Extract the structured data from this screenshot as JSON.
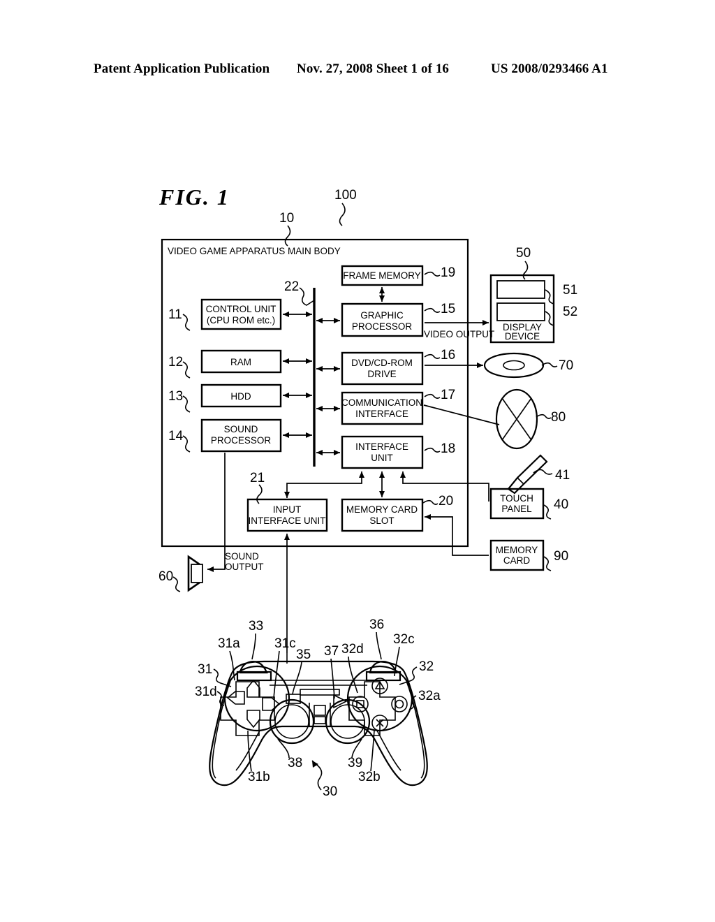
{
  "header": {
    "publication": "Patent Application Publication",
    "date_sheet": "Nov. 27, 2008  Sheet 1 of 16",
    "patent_number": "US 2008/0293466 A1"
  },
  "figure": {
    "label": "FIG.  1",
    "system_ref": "100",
    "main_body_ref": "10",
    "main_body_title": "VIDEO GAME APPARATUS MAIN BODY"
  },
  "blocks": {
    "control_unit": {
      "line1": "CONTROL UNIT",
      "line2": "(CPU ROM etc.)",
      "ref": "11"
    },
    "ram": {
      "line1": "RAM",
      "ref": "12"
    },
    "hdd": {
      "line1": "HDD",
      "ref": "13"
    },
    "sound_processor": {
      "line1": "SOUND",
      "line2": "PROCESSOR",
      "ref": "14"
    },
    "frame_memory": {
      "line1": "FRAME MEMORY",
      "ref": "19"
    },
    "graphic_processor": {
      "line1": "GRAPHIC",
      "line2": "PROCESSOR",
      "ref": "15"
    },
    "dvd_drive": {
      "line1": "DVD/CD-ROM",
      "line2": "DRIVE",
      "ref": "16"
    },
    "communication_interface": {
      "line1": "COMMUNICATION",
      "line2": "INTERFACE",
      "ref": "17"
    },
    "interface_unit": {
      "line1": "INTERFACE",
      "line2": "UNIT",
      "ref": "18"
    },
    "input_interface_unit": {
      "line1": "INPUT",
      "line2": "INTERFACE UNIT",
      "ref": "21"
    },
    "memory_card_slot": {
      "line1": "MEMORY CARD",
      "line2": "SLOT",
      "ref": "20"
    },
    "display_device": {
      "line1": "DISPLAY",
      "line2": "DEVICE",
      "ref": "50",
      "screen_upper_ref": "51",
      "screen_lower_ref": "52"
    },
    "touch_panel": {
      "line1": "TOUCH",
      "line2": "PANEL",
      "ref": "40",
      "stylus_ref": "41"
    },
    "memory_card": {
      "line1": "MEMORY",
      "line2": "CARD",
      "ref": "90"
    },
    "disc": {
      "ref": "70"
    },
    "network": {
      "ref": "80"
    },
    "speaker": {
      "ref": "60"
    },
    "bus": {
      "ref": "22"
    }
  },
  "signal_labels": {
    "video_output": "VIDEO OUTPUT",
    "sound_output_line1": "SOUND",
    "sound_output_line2": "OUTPUT"
  },
  "controller": {
    "ref": "30",
    "left_group_ref": "31",
    "right_group_ref": "32",
    "refs": [
      "31",
      "31a",
      "31b",
      "31c",
      "31d",
      "32",
      "32a",
      "32b",
      "32c",
      "32d",
      "33",
      "35",
      "36",
      "37",
      "38",
      "39",
      "30"
    ]
  }
}
